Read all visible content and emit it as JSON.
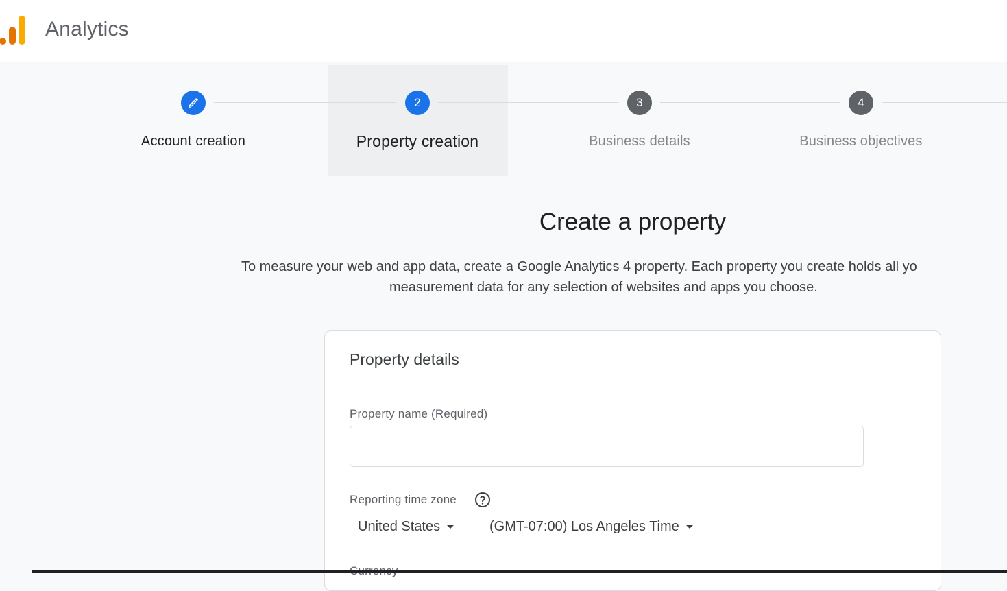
{
  "app": {
    "title": "Analytics"
  },
  "stepper": {
    "steps": [
      {
        "label": "Account creation",
        "number": "",
        "state": "done"
      },
      {
        "label": "Property creation",
        "number": "2",
        "state": "active"
      },
      {
        "label": "Business details",
        "number": "3",
        "state": "pending"
      },
      {
        "label": "Business objectives",
        "number": "4",
        "state": "pending"
      }
    ]
  },
  "main": {
    "title": "Create a property",
    "description_line1": "To measure your web and app data, create a Google Analytics 4 property. Each property you create holds all yo",
    "description_line2": "measurement data for any selection of websites and apps you choose."
  },
  "card": {
    "title": "Property details",
    "property_name_label": "Property name (Required)",
    "property_name_value": "",
    "time_zone_label": "Reporting time zone",
    "country_value": "United States",
    "time_zone_value": "(GMT-07:00) Los Angeles Time",
    "currency_label": "Currency"
  },
  "colors": {
    "accent": "#1a73e8",
    "pending": "#5f6368",
    "logo_dark": "#e37400",
    "logo_light": "#f9ab00"
  },
  "icons": {
    "logo": "analytics-logo-icon",
    "done_step": "pencil-icon",
    "help": "help-circle-icon",
    "dropdown": "caret-down-icon"
  }
}
